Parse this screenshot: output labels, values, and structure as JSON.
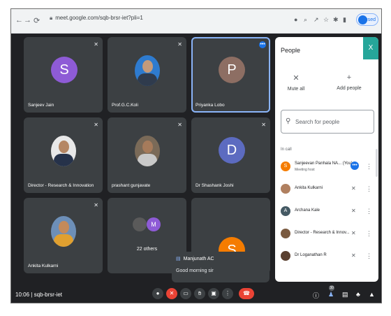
{
  "browser": {
    "url": "meet.google.com/sqb-brsr-iet?pli=1",
    "profile_label": "Paused"
  },
  "tiles": [
    {
      "name": "Sanjeev Jain",
      "initial": "S",
      "color": "#8e5bd6"
    },
    {
      "name": "Prof.G.C.Koli"
    },
    {
      "name": "Priyanka Lobo",
      "initial": "P",
      "color": "#8d6e63"
    },
    {
      "name": "Director - Research & Innovation"
    },
    {
      "name": "prashant gunjavate"
    },
    {
      "name": "Dr Shashank Joshi",
      "initial": "D",
      "color": "#5c6bc0"
    },
    {
      "name": "Ankita Kulkarni"
    },
    {
      "others_label": "22 others",
      "mini_initial": "M"
    },
    {
      "initial": "S",
      "color": "#f57c00"
    }
  ],
  "chat": {
    "sender": "Manjunath AC",
    "message": "Good morning sir"
  },
  "meeting": {
    "time": "10:06",
    "code": "sqb-brsr-iet",
    "separator": "|"
  },
  "controls": {
    "participant_count": "30"
  },
  "people": {
    "title": "People",
    "close_label": "X",
    "mute_all_label": "Mute all",
    "add_people_label": "Add people",
    "search_placeholder": "Search for people",
    "section_label": "In call",
    "participants": [
      {
        "initial": "S",
        "color": "#f57c00",
        "name": "Sanjeevan Panhala NA...  (You)",
        "sub": "Meeting host"
      },
      {
        "name": "Ankita Kulkarni"
      },
      {
        "initial": "A",
        "color": "#455a64",
        "name": "Archana Kale"
      },
      {
        "name": "Director - Research & Innov..."
      },
      {
        "name": "Dr Loganathan R"
      }
    ]
  }
}
